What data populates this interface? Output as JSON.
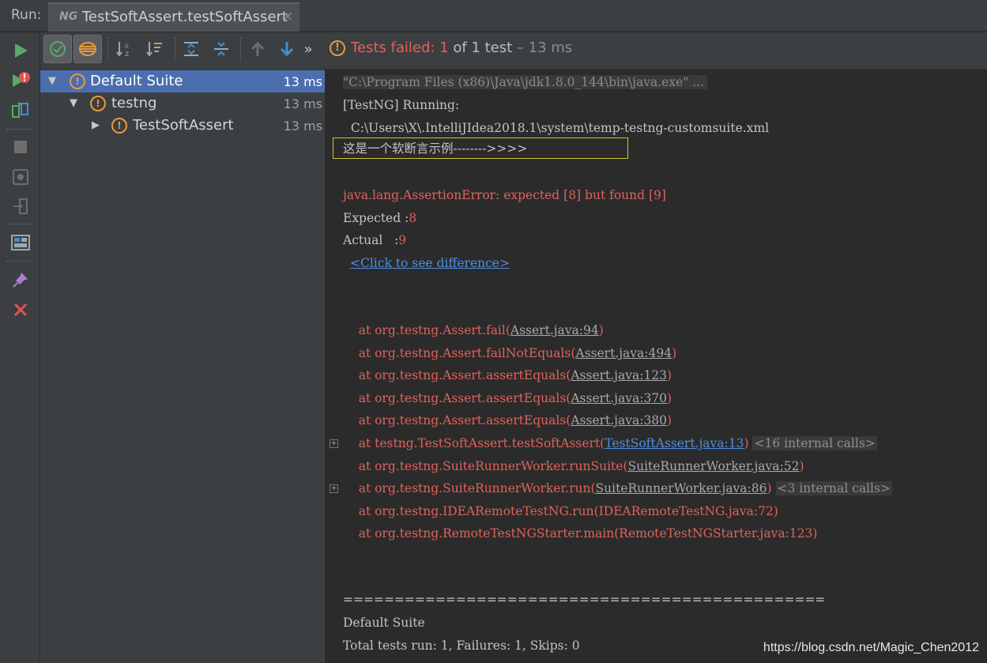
{
  "run_label": "Run:",
  "tab": {
    "badge": "NG",
    "title": "TestSoftAssert.testSoftAssert",
    "close": "×"
  },
  "leftbar_icons": [
    "rerun-icon",
    "rerun-failed-icon",
    "toggle-auto-test-icon",
    "stop-icon",
    "dump-threads-icon",
    "exit-icon",
    "layout-icon",
    "pin-icon",
    "close-icon"
  ],
  "toolbar": {
    "status_icon": "!",
    "status_prefix": "Tests failed: ",
    "status_count": "1",
    "status_mid": " of 1 test",
    "status_time": " – 13 ms"
  },
  "tree": [
    {
      "label": "Default Suite",
      "time": "13 ms",
      "icon": "!",
      "arrow": "▼",
      "selected": true
    },
    {
      "label": "testng",
      "time": "13 ms",
      "icon": "!",
      "arrow": "▼",
      "selected": false
    },
    {
      "label": "TestSoftAssert",
      "time": "13 ms",
      "icon": "!",
      "arrow": "▶",
      "selected": false
    }
  ],
  "console": {
    "cmd": "\"C:\\Program Files (x86)\\Java\\jdk1.8.0_144\\bin\\java.exe\" ...",
    "running": "[TestNG] Running:",
    "suite_path": "  C:\\Users\\X\\.IntelliJIdea2018.1\\system\\temp-testng-customsuite.xml",
    "message": "这是一个软断言示例-------->>>>",
    "error": "java.lang.AssertionError: expected [8] but found [9]",
    "expected_label": "Expected :",
    "expected_value": "8",
    "actual_label": "Actual   :",
    "actual_value": "9",
    "diff_link": "<Click to see difference>",
    "stack": [
      {
        "prefix": "    at org.testng.Assert.fail(",
        "link": "Assert.java:94",
        "suffix": ")",
        "link_style": "ulink",
        "internal": ""
      },
      {
        "prefix": "    at org.testng.Assert.failNotEquals(",
        "link": "Assert.java:494",
        "suffix": ")",
        "link_style": "ulink",
        "internal": ""
      },
      {
        "prefix": "    at org.testng.Assert.assertEquals(",
        "link": "Assert.java:123",
        "suffix": ")",
        "link_style": "ulink",
        "internal": ""
      },
      {
        "prefix": "    at org.testng.Assert.assertEquals(",
        "link": "Assert.java:370",
        "suffix": ")",
        "link_style": "ulink",
        "internal": ""
      },
      {
        "prefix": "    at org.testng.Assert.assertEquals(",
        "link": "Assert.java:380",
        "suffix": ")",
        "link_style": "ulink",
        "internal": ""
      },
      {
        "prefix": "    at testng.TestSoftAssert.testSoftAssert(",
        "link": "TestSoftAssert.java:13",
        "suffix": ")",
        "link_style": "link",
        "internal": "<16 internal calls>"
      },
      {
        "prefix": "    at org.testng.SuiteRunnerWorker.runSuite(",
        "link": "SuiteRunnerWorker.java:52",
        "suffix": ")",
        "link_style": "ulink",
        "internal": ""
      },
      {
        "prefix": "    at org.testng.SuiteRunnerWorker.run(",
        "link": "SuiteRunnerWorker.java:86",
        "suffix": ")",
        "link_style": "ulink",
        "internal": "<3 internal calls>"
      },
      {
        "prefix": "    at org.testng.IDEARemoteTestNG.run(IDEARemoteTestNG.java:72)",
        "link": "",
        "suffix": "",
        "link_style": "",
        "internal": ""
      },
      {
        "prefix": "    at org.testng.RemoteTestNGStarter.main(RemoteTestNGStarter.java:123)",
        "link": "",
        "suffix": "",
        "link_style": "",
        "internal": ""
      }
    ],
    "fold_marker": "+",
    "separator": "===============================================",
    "suite_name": "Default Suite",
    "totals": "Total tests run: 1, Failures: 1, Skips: 0"
  },
  "watermark": "https://blog.csdn.net/Magic_Chen2012"
}
